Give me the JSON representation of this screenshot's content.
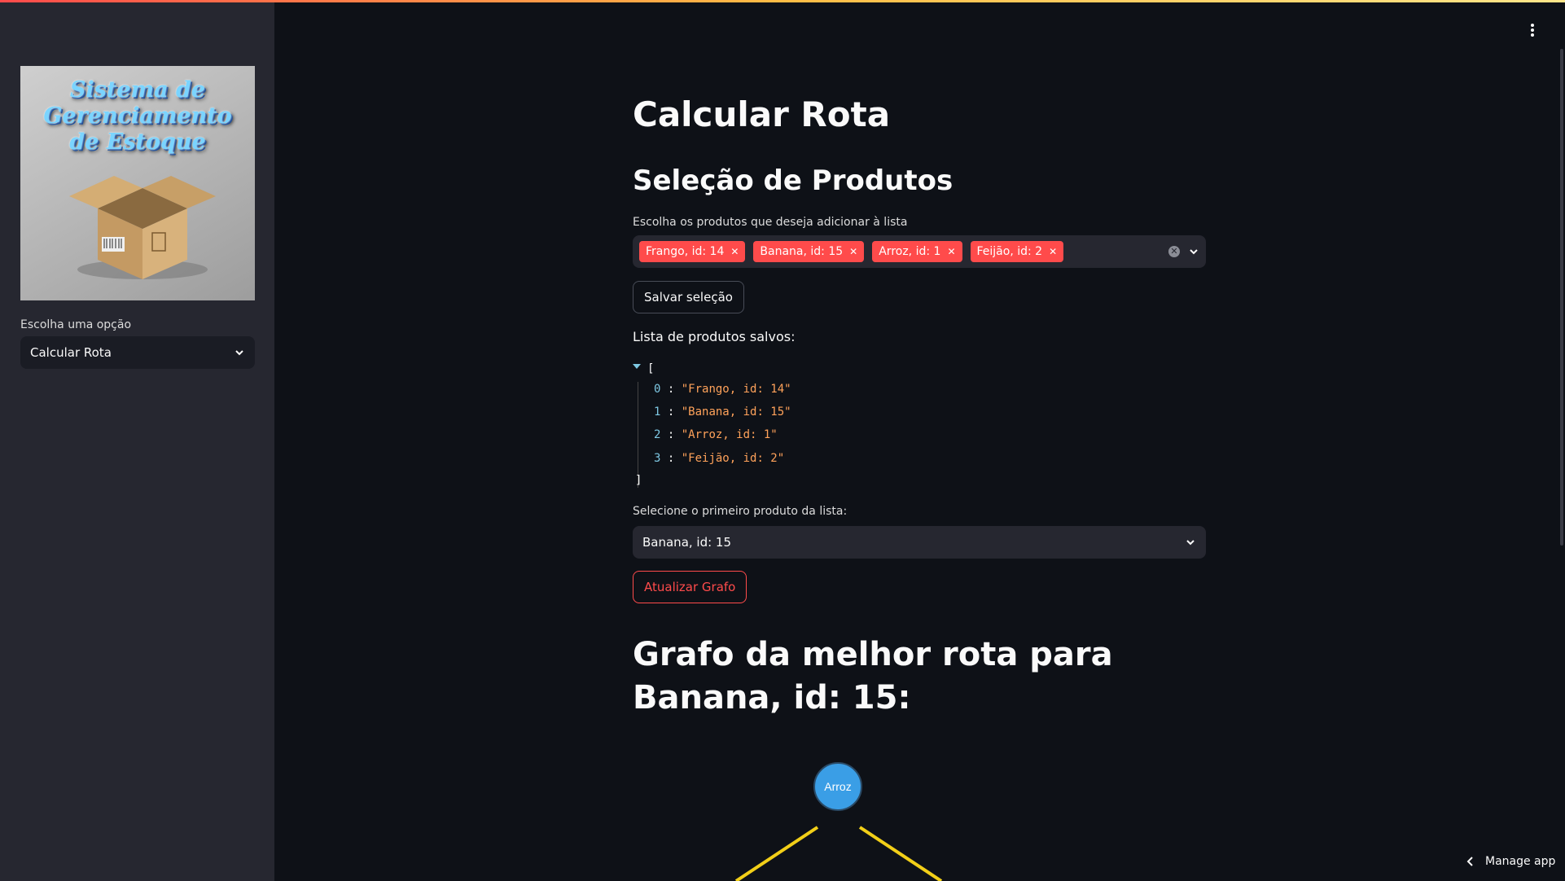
{
  "sidebar": {
    "logo_text": [
      "Sistema de",
      "Gerenciamento",
      "de Estoque"
    ],
    "select_label": "Escolha uma opção",
    "select_value": "Calcular Rota"
  },
  "main": {
    "title": "Calcular Rota",
    "section_title": "Seleção de Produtos",
    "multiselect_label": "Escolha os produtos que deseja adicionar à lista",
    "chips": [
      "Frango, id: 14",
      "Banana, id: 15",
      "Arroz, id: 1",
      "Feijão, id: 2"
    ],
    "save_button": "Salvar seleção",
    "saved_list_label": "Lista de produtos salvos:",
    "json_open": "[",
    "json_close": "]",
    "saved_items": [
      {
        "index": "0",
        "value": "\"Frango, id: 14\""
      },
      {
        "index": "1",
        "value": "\"Banana, id: 15\""
      },
      {
        "index": "2",
        "value": "\"Arroz, id: 1\""
      },
      {
        "index": "3",
        "value": "\"Feijão, id: 2\""
      }
    ],
    "first_product_label": "Selecione o primeiro produto da lista:",
    "first_product_value": "Banana, id: 15",
    "update_button": "Atualizar Grafo",
    "graph_title": "Grafo da melhor rota para Banana, id: 15:",
    "graph": {
      "node_label": "Arroz",
      "node_color": "#3a9ee6",
      "edge_color": "#f2cf18"
    }
  },
  "footer": {
    "manage_app": "Manage app"
  },
  "colors": {
    "accent": "#ff4b4b",
    "background": "#0e1117",
    "sidebar": "#262730"
  }
}
